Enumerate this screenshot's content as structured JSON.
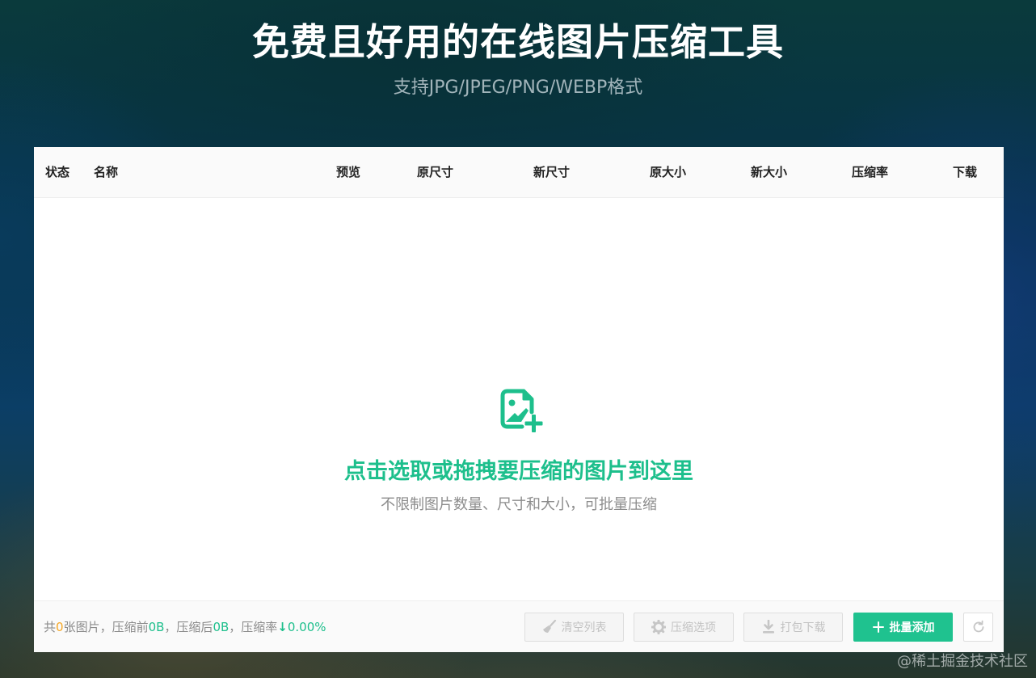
{
  "hero": {
    "title": "免费且好用的在线图片压缩工具",
    "subtitle": "支持JPG/JPEG/PNG/WEBP格式"
  },
  "table": {
    "columns": [
      "状态",
      "名称",
      "预览",
      "原尺寸",
      "新尺寸",
      "原大小",
      "新大小",
      "压缩率",
      "下载"
    ]
  },
  "dropzone": {
    "icon": "image-add-icon",
    "title": "点击选取或拖拽要压缩的图片到这里",
    "hint": "不限制图片数量、尺寸和大小，可批量压缩"
  },
  "footer": {
    "stats": {
      "prefix": "共",
      "count": "0",
      "count_suffix": "张图片，压缩前",
      "before_size": "0B",
      "after_label": "，压缩后",
      "after_size": "0B",
      "rate_label": "，压缩率",
      "rate_arrow": "↓",
      "rate_value": "0.00%"
    },
    "buttons": {
      "clear_list": "清空列表",
      "compress_options": "压缩选项",
      "pack_download": "打包下载",
      "batch_add": "批量添加"
    }
  },
  "watermark": "@稀土掘金技术社区",
  "colors": {
    "accent_green": "#1dbf8c",
    "count_orange": "#f5a623"
  }
}
